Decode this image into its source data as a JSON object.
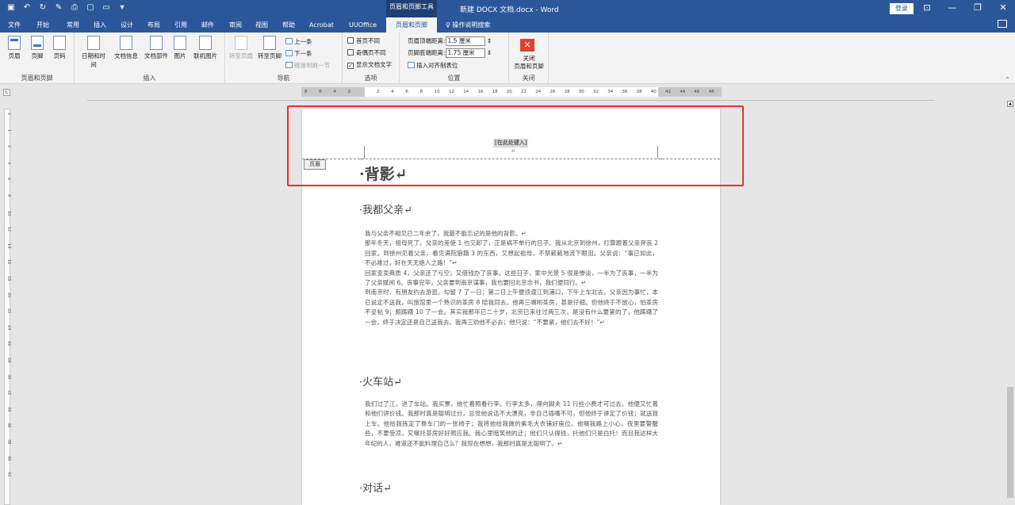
{
  "window": {
    "context_tab_title": "页眉和页脚工具",
    "doc_title": "新建 DOCX 文档.docx  -  Word",
    "login_label": "登录"
  },
  "tabs": [
    "文件",
    "开始",
    "常用",
    "插入",
    "设计",
    "布局",
    "引用",
    "邮件",
    "审阅",
    "视图",
    "帮助",
    "Acrobat",
    "UUOffice",
    "页眉和页脚"
  ],
  "active_tab": "页眉和页脚",
  "search_label": "操作说明搜索",
  "ribbon": {
    "group_header_footer": {
      "label": "页眉和页脚",
      "buttons": [
        "页眉",
        "页脚",
        "页码"
      ]
    },
    "group_insert": {
      "label": "插入",
      "buttons": [
        "日期和时间",
        "文档信息",
        "文档部件",
        "图片",
        "联机图片"
      ]
    },
    "group_nav": {
      "label": "导航",
      "goto_header": "转至页眉",
      "goto_footer": "转至页脚",
      "prev": "上一条",
      "next": "下一条",
      "link_prev": "链接到前一节"
    },
    "group_options": {
      "label": "选项",
      "first_page": "首页不同",
      "odd_even": "奇偶页不同",
      "show_text": "显示文档文字",
      "show_text_checked": true
    },
    "group_position": {
      "label": "位置",
      "header_top_label": "页眉顶端距离:",
      "header_top_value": "1.5 厘米",
      "footer_bottom_label": "页脚底端距离:",
      "footer_bottom_value": "1.75 厘米",
      "align_tab": "插入对齐制表位"
    },
    "group_close": {
      "label": "关闭",
      "close_label_1": "关闭",
      "close_label_2": "页眉和页脚"
    }
  },
  "ruler": {
    "ticks": [
      "8",
      "6",
      "4",
      "2",
      "",
      "2",
      "4",
      "6",
      "8",
      "10",
      "12",
      "14",
      "16",
      "18",
      "20",
      "22",
      "24",
      "26",
      "28",
      "30",
      "32",
      "34",
      "36",
      "38",
      "40",
      "42",
      "44",
      "46",
      "48"
    ],
    "vticks": [
      "2",
      "1",
      "2",
      "4",
      "6",
      "8",
      "10",
      "12",
      "14",
      "16",
      "18",
      "20",
      "22",
      "24",
      "26",
      "28",
      "30",
      "32",
      "34",
      "36",
      "38",
      "40",
      "42"
    ]
  },
  "document": {
    "header_placeholder": "[在此处键入]",
    "header_tag": "页眉",
    "title": "背影",
    "sections": [
      {
        "heading": "我都父亲",
        "paragraphs": [
          "我与父亲不相见已二年余了，我最不能忘记的是他的背影。↵",
          "那年冬天，祖母死了，父亲的差使 1 也交卸了，正是祸不单行的日子。我从北京到徐州，打算跟着父亲奔丧 2 回家。到徐州见着父亲，看见满院狼藉 3 的东西，又想起祖母，不禁簌簌地流下眼泪。父亲说：“事已如此，不必难过，好在天无绝人之路！”↵",
          "回家变卖典质 4，父亲还了亏空；又借钱办了丧事。这些日子，家中光景 5 很是惨淡，一半为了丧事，一半为了父亲赋闲 6。丧事完毕，父亲要到南京谋事，我也要回北京念书，我们便同行。↵",
          "到南京时，有朋友约去游逛，勾留 7 了一日；第二日上午便须渡江到浦口，下午上车北去。父亲因为事忙，本已说定不送我，叫旅馆里一个熟识的茶房 8 陪我同去。他再三嘱咐茶房，甚是仔细。但他终于不放心，怕茶房不妥帖 9；颇踌躇 10 了一会。其实我那年已二十岁，北京已来往过两三次，是没有什么要紧的了。他踌躇了一会，终于决定还是自己送我去。我再三劝他不必去；他只说：“不要紧，他们去不好！”↵"
        ]
      },
      {
        "heading": "火车站",
        "paragraphs": [
          "我们过了江，进了车站。我买票，他忙着照看行李。行李太多，得向脚夫 11 行些小费才可过去。他便又忙着和他们讲价钱。我那时真是聪明过分，总觉他说话不大漂亮，非自己插嘴不可，但他终于讲定了价钱；就送我上车。他给我拣定了靠车门的一张椅子；我将他给我做的紫毛大衣铺好座位。他嘱我路上小心，夜里要警醒些，不要受凉。又嘱托茶房好好照应我。我心里暗笑他的迂；他们只认得钱，托他们只是白托！而且我这样大年纪的人，难道还不能料理自己么？我现在想想，我那时真是太聪明了。↵"
        ]
      },
      {
        "heading": "对话",
        "paragraphs": []
      }
    ]
  },
  "colors": {
    "title_bar": "#2b579a",
    "highlight": "#e0342b",
    "close_button": "#d9432f"
  }
}
